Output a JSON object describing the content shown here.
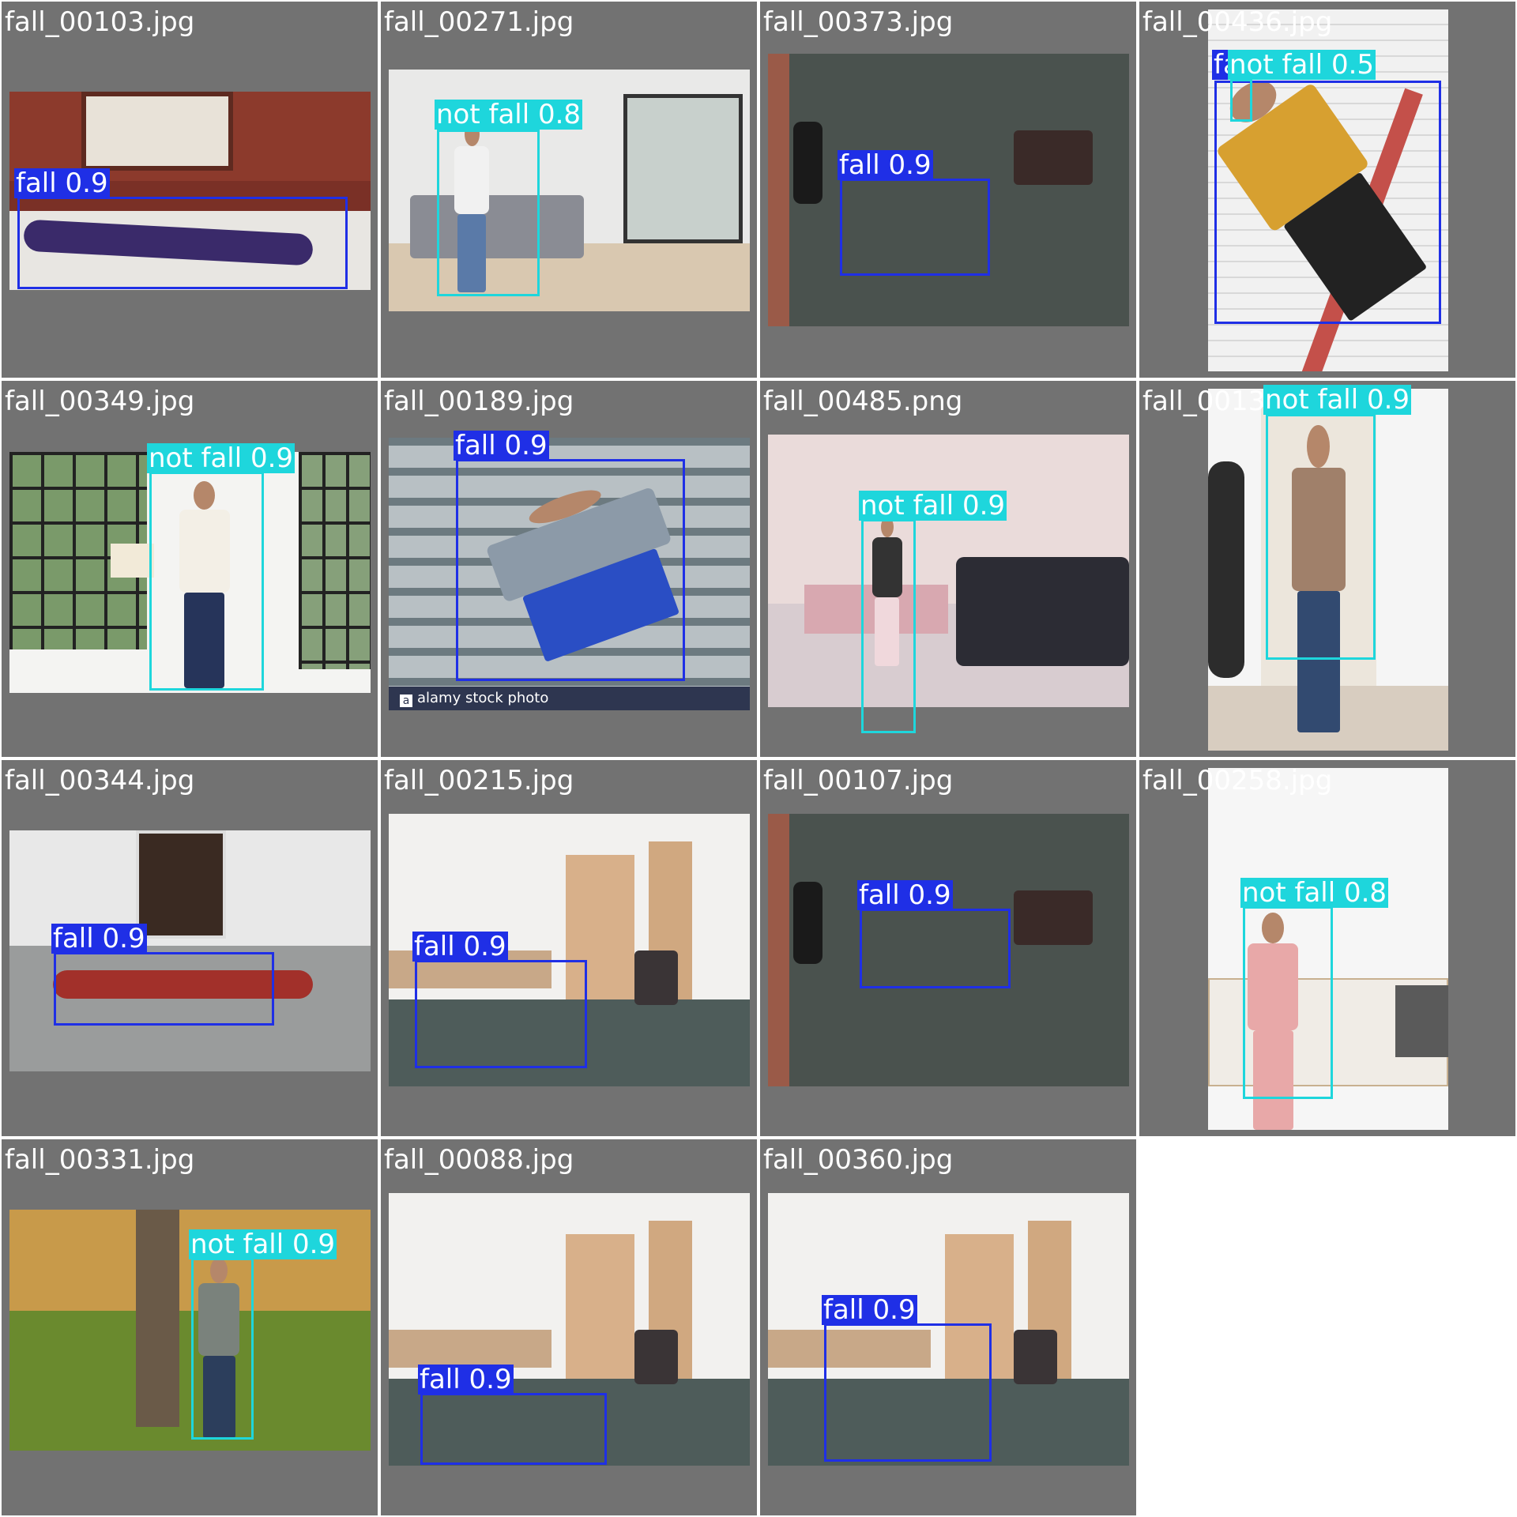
{
  "colors": {
    "fall": "#1f2fe6",
    "not_fall": "#1ed6dc",
    "tile_bg": "#727272"
  },
  "tiles": [
    {
      "file": "fall_00103.jpg",
      "scene": "room-window",
      "detections": [
        {
          "cls": "fall",
          "label": "fall 0.9",
          "conf": 0.9
        }
      ]
    },
    {
      "file": "fall_00271.jpg",
      "scene": "living-room",
      "detections": [
        {
          "cls": "not_fall",
          "label": "not fall 0.8",
          "conf": 0.8
        }
      ]
    },
    {
      "file": "fall_00373.jpg",
      "scene": "overhead-floor",
      "detections": [
        {
          "cls": "fall",
          "label": "fall 0.9",
          "conf": 0.9
        }
      ]
    },
    {
      "file": "fall_00436.jpg",
      "scene": "ladder",
      "detections": [
        {
          "cls": "fall",
          "label": "fall 0.9",
          "conf": 0.9
        },
        {
          "cls": "not_fall",
          "label": "not fall 0.5",
          "conf": 0.5
        }
      ]
    },
    {
      "file": "fall_00349.jpg",
      "scene": "sunroom",
      "detections": [
        {
          "cls": "not_fall",
          "label": "not fall 0.9",
          "conf": 0.9
        }
      ]
    },
    {
      "file": "fall_00189.jpg",
      "scene": "stairs",
      "watermark": "alamy stock photo",
      "detections": [
        {
          "cls": "fall",
          "label": "fall 0.9",
          "conf": 0.9
        }
      ]
    },
    {
      "file": "fall_00485.png",
      "scene": "bedroom-sofa",
      "detections": [
        {
          "cls": "not_fall",
          "label": "not fall 0.9",
          "conf": 0.9
        }
      ]
    },
    {
      "file": "fall_00136.jpg",
      "scene": "doorway",
      "detections": [
        {
          "cls": "not_fall",
          "label": "not fall 0.9",
          "conf": 0.9
        }
      ]
    },
    {
      "file": "fall_00344.jpg",
      "scene": "grey-room",
      "detections": [
        {
          "cls": "fall",
          "label": "fall 0.9",
          "conf": 0.9
        }
      ]
    },
    {
      "file": "fall_00215.jpg",
      "scene": "office",
      "detections": [
        {
          "cls": "fall",
          "label": "fall 0.9",
          "conf": 0.9
        }
      ]
    },
    {
      "file": "fall_00107.jpg",
      "scene": "overhead-floor",
      "detections": [
        {
          "cls": "fall",
          "label": "fall 0.9",
          "conf": 0.9
        }
      ]
    },
    {
      "file": "fall_00258.jpg",
      "scene": "kitchen",
      "detections": [
        {
          "cls": "not_fall",
          "label": "not fall 0.8",
          "conf": 0.8
        }
      ]
    },
    {
      "file": "fall_00331.jpg",
      "scene": "park",
      "detections": [
        {
          "cls": "not_fall",
          "label": "not fall 0.9",
          "conf": 0.9
        }
      ]
    },
    {
      "file": "fall_00088.jpg",
      "scene": "office",
      "detections": [
        {
          "cls": "fall",
          "label": "fall 0.9",
          "conf": 0.9
        }
      ]
    },
    {
      "file": "fall_00360.jpg",
      "scene": "office",
      "detections": [
        {
          "cls": "fall",
          "label": "fall 0.9",
          "conf": 0.9
        }
      ]
    }
  ]
}
